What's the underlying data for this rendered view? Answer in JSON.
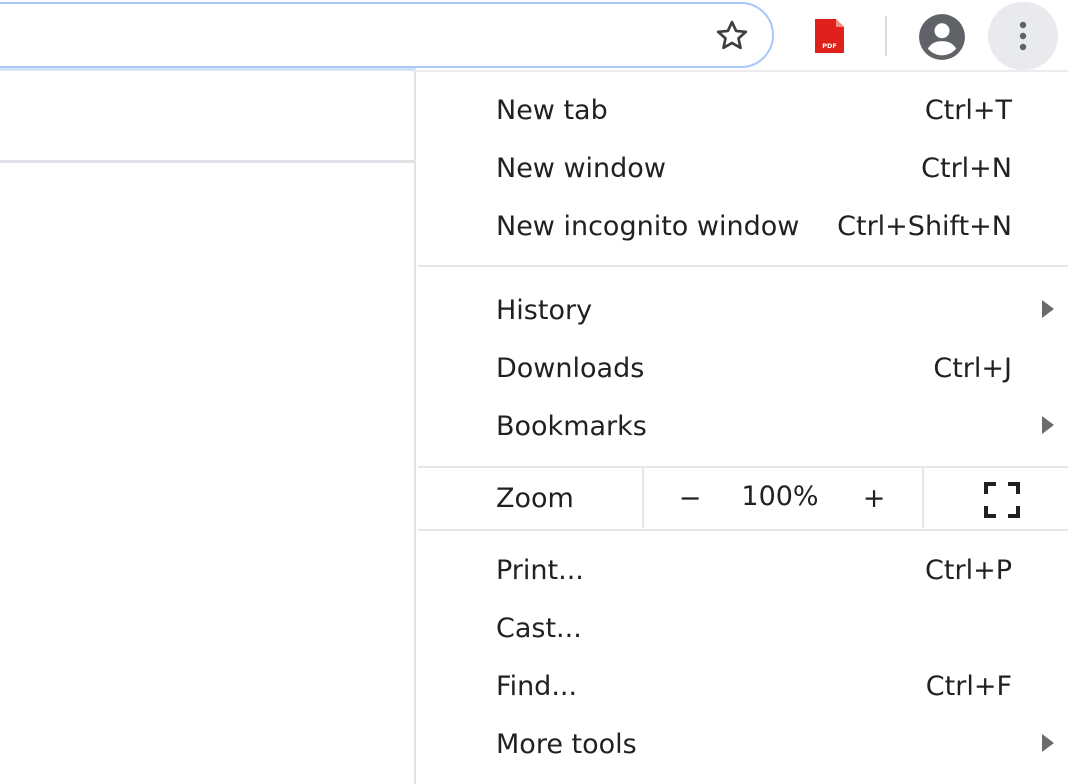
{
  "toolbar": {
    "icons": {
      "bookmark": "star-outline-icon",
      "extension": "pdf-icon",
      "profile": "account-circle-icon",
      "menu": "three-dots-vertical-icon"
    },
    "pdf_badge": "PDF"
  },
  "menu": {
    "items": [
      {
        "label": "New tab",
        "shortcut": "Ctrl+T"
      },
      {
        "label": "New window",
        "shortcut": "Ctrl+N"
      },
      {
        "label": "New incognito window",
        "shortcut": "Ctrl+Shift+N"
      },
      {
        "label": "History",
        "shortcut": ""
      },
      {
        "label": "Downloads",
        "shortcut": "Ctrl+J"
      },
      {
        "label": "Bookmarks",
        "shortcut": ""
      },
      {
        "label": "Print...",
        "shortcut": "Ctrl+P"
      },
      {
        "label": "Cast...",
        "shortcut": ""
      },
      {
        "label": "Find...",
        "shortcut": "Ctrl+F"
      },
      {
        "label": "More tools",
        "shortcut": ""
      }
    ],
    "zoom": {
      "label": "Zoom",
      "minus": "−",
      "value": "100%",
      "plus": "+"
    }
  },
  "colors": {
    "accent_border": "#a8c7fa",
    "pdf_red": "#e0201b",
    "icon_gray": "#5f6368",
    "menu_button_bg": "#e8eaed"
  }
}
